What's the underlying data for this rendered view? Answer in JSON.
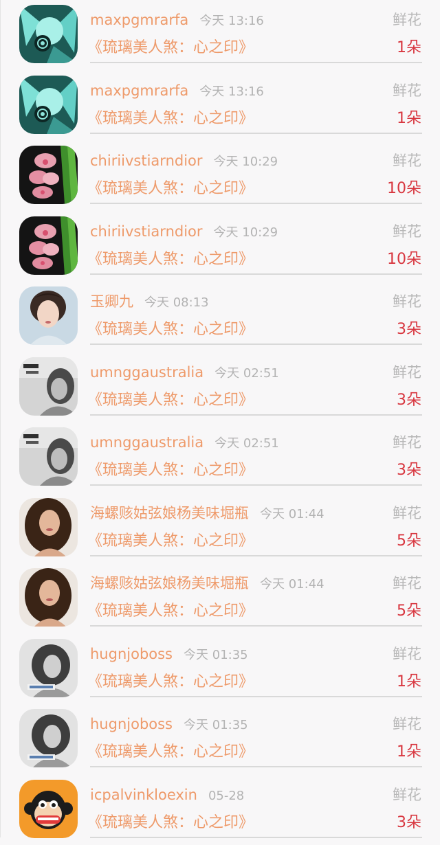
{
  "gift_list": {
    "items": [
      {
        "user": "maxpgmrarfa",
        "time": "今天 13:16",
        "gift": "鲜花",
        "book": "《琉璃美人煞：心之印》",
        "count": "1朵",
        "avatar": "anime-avatar-icon"
      },
      {
        "user": "maxpgmrarfa",
        "time": "今天 13:16",
        "gift": "鲜花",
        "book": "《琉璃美人煞：心之印》",
        "count": "1朵",
        "avatar": "anime-avatar-icon"
      },
      {
        "user": "chiriivstiarndior",
        "time": "今天 10:29",
        "gift": "鲜花",
        "book": "《琉璃美人煞：心之印》",
        "count": "10朵",
        "avatar": "orchid-avatar-icon"
      },
      {
        "user": "chiriivstiarndior",
        "time": "今天 10:29",
        "gift": "鲜花",
        "book": "《琉璃美人煞：心之印》",
        "count": "10朵",
        "avatar": "orchid-avatar-icon"
      },
      {
        "user": "玉卿九",
        "time": "今天 08:13",
        "gift": "鲜花",
        "book": "《琉璃美人煞：心之印》",
        "count": "3朵",
        "avatar": "woman-portrait-avatar-icon"
      },
      {
        "user": "umnggaustralia",
        "time": "今天 02:51",
        "gift": "鲜花",
        "book": "《琉璃美人煞：心之印》",
        "count": "3朵",
        "avatar": "grayscale-girl-avatar-icon"
      },
      {
        "user": "umnggaustralia",
        "time": "今天 02:51",
        "gift": "鲜花",
        "book": "《琉璃美人煞：心之印》",
        "count": "3朵",
        "avatar": "grayscale-girl-avatar-icon"
      },
      {
        "user": "海螺赅姑弦娘杨美味堀瓶",
        "time": "今天 01:44",
        "gift": "鲜花",
        "book": "《琉璃美人煞：心之印》",
        "count": "5朵",
        "avatar": "brunette-woman-avatar-icon"
      },
      {
        "user": "海螺赅姑弦娘杨美味堀瓶",
        "time": "今天 01:44",
        "gift": "鲜花",
        "book": "《琉璃美人煞：心之印》",
        "count": "5朵",
        "avatar": "brunette-woman-avatar-icon"
      },
      {
        "user": "hugnjoboss",
        "time": "今天 01:35",
        "gift": "鲜花",
        "book": "《琉璃美人煞：心之印》",
        "count": "1朵",
        "avatar": "bw-woman-avatar-icon"
      },
      {
        "user": "hugnjoboss",
        "time": "今天 01:35",
        "gift": "鲜花",
        "book": "《琉璃美人煞：心之印》",
        "count": "1朵",
        "avatar": "bw-woman-avatar-icon"
      },
      {
        "user": "icpalvinkloexin",
        "time": "05-28",
        "gift": "鲜花",
        "book": "《琉璃美人煞：心之印》",
        "count": "3朵",
        "avatar": "monkey-avatar-icon"
      }
    ]
  }
}
